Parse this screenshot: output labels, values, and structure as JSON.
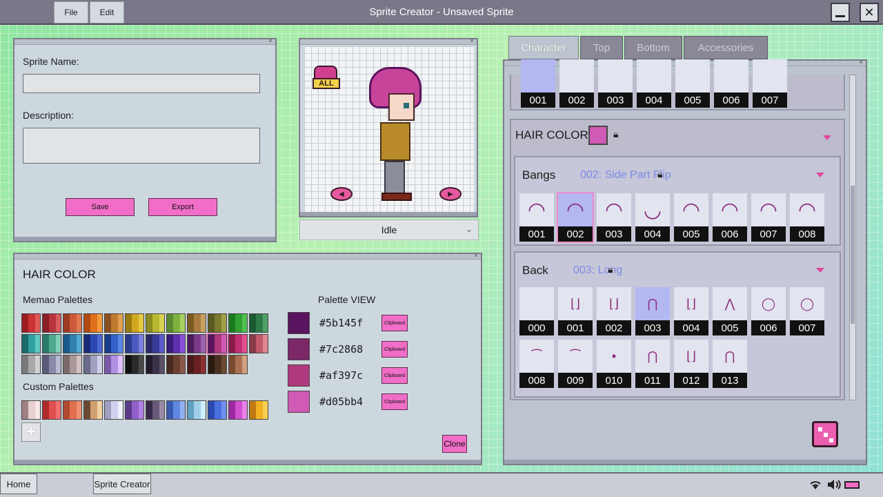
{
  "window": {
    "title": "Sprite Creator - Unsaved Sprite"
  },
  "menu": {
    "file": "File",
    "edit": "Edit"
  },
  "window_controls": {
    "minimize": "—",
    "close": "✕"
  },
  "sprite_info": {
    "name_label": "Sprite Name:",
    "description_label": "Description:",
    "save": "Save",
    "export": "Export"
  },
  "preview": {
    "animation_selected": "Idle",
    "all_badge": "ALL",
    "prev_arrow": "◀",
    "next_arrow": "▶"
  },
  "palette_panel": {
    "title": "HAIR COLOR",
    "memao_label": "Memao Palettes",
    "custom_label": "Custom Palettes",
    "view_label": "Palette VIEW",
    "clipboard_label": "Clipboard",
    "clone": "Clone",
    "colors": [
      {
        "hex": "#5b145f"
      },
      {
        "hex": "#7c2868"
      },
      {
        "hex": "#af397c"
      },
      {
        "hex": "#d05bb4"
      }
    ],
    "memao_swatches": [
      [
        "#9b1d22",
        "#cc3335",
        "#e05a5a"
      ],
      [
        "#8a1f26",
        "#b8343c",
        "#d85a5e"
      ],
      [
        "#9c3a22",
        "#cc5a3a",
        "#e07a50"
      ],
      [
        "#b04a10",
        "#e0701a",
        "#f59a3a"
      ],
      [
        "#8a5020",
        "#c07a30",
        "#e0a050"
      ],
      [
        "#9a7a10",
        "#d0a820",
        "#e8c840"
      ],
      [
        "#8a8a20",
        "#b8b830",
        "#d8d050"
      ],
      [
        "#5a8a30",
        "#80b040",
        "#a8d060"
      ],
      [
        "#7a5a20",
        "#a87a40",
        "#c8a060"
      ],
      [
        "#5a5a20",
        "#7a7a30",
        "#a0a048"
      ],
      [
        "#1a7a20",
        "#30a030",
        "#50c050"
      ],
      [
        "#1a5a30",
        "#307a48",
        "#50a068"
      ],
      [
        "#1a6a6a",
        "#30a0a0",
        "#60c8c0"
      ],
      [
        "#2a7a6a",
        "#50a890",
        "#80d0b8"
      ],
      [
        "#1a5a8a",
        "#3080b0",
        "#50a8d0"
      ],
      [
        "#1a2a7a",
        "#2a48b0",
        "#4a68d0"
      ],
      [
        "#1a3a8a",
        "#3060c8",
        "#5a88e8"
      ],
      [
        "#2a3a8a",
        "#4a5ac0",
        "#7a80e0"
      ],
      [
        "#2a2a6a",
        "#3a3a9a",
        "#5a5ac8"
      ],
      [
        "#3a1a7a",
        "#6030b0",
        "#8a50d8"
      ],
      [
        "#4a1a5a",
        "#7a3a8a",
        "#a060b0"
      ],
      [
        "#5b145f",
        "#af397c",
        "#d05bb4"
      ],
      [
        "#8a1a4a",
        "#c03070",
        "#e05090"
      ],
      [
        "#8a3a4a",
        "#c05a6a",
        "#e08890"
      ],
      [
        "#7a7a7a",
        "#a8a8a8",
        "#d0d0d0"
      ],
      [
        "#5a5a7a",
        "#8a8aa8",
        "#b8b8d0"
      ],
      [
        "#7a6a6a",
        "#a89898",
        "#d0c0c0"
      ],
      [
        "#6a6a8a",
        "#a0a0c0",
        "#d0d0e8"
      ],
      [
        "#7a5aa8",
        "#b090e0",
        "#e0c0ff"
      ],
      [
        "#101010",
        "#2a2a2a",
        "#4a4a4a"
      ],
      [
        "#201a2a",
        "#3a3048",
        "#5a5068"
      ],
      [
        "#4a2a20",
        "#6a4030",
        "#8a5a48"
      ],
      [
        "#4a1a1a",
        "#6a2020",
        "#8a3030"
      ],
      [
        "#2a1a10",
        "#4a3020",
        "#6a4a30"
      ],
      [
        "#7a4a30",
        "#a87050",
        "#d0a080"
      ]
    ],
    "custom_swatches": [
      [
        "#a08080",
        "#e8d0d0",
        "#f8e8e8"
      ],
      [
        "#b02a2a",
        "#e05050",
        "#f07070"
      ],
      [
        "#b04a30",
        "#e07050",
        "#f09070"
      ],
      [
        "#6a4a30",
        "#d0a070",
        "#f0d0a0"
      ],
      [
        "#a0a0c0",
        "#d0d0f0",
        "#f0f0ff"
      ],
      [
        "#5a3a8a",
        "#9060c8",
        "#b080e8"
      ],
      [
        "#3a2a4a",
        "#6a5a7a",
        "#9a8aa8"
      ],
      [
        "#3a5ab0",
        "#6088e0",
        "#90b0f0"
      ],
      [
        "#60a0c0",
        "#a0d0e8",
        "#d0f0ff"
      ],
      [
        "#2a4ab0",
        "#4a70e0",
        "#7090f0"
      ],
      [
        "#9a2aa0",
        "#d050d0",
        "#e880e8"
      ],
      [
        "#c07a10",
        "#f0b020",
        "#f8d050"
      ]
    ]
  },
  "tabs": [
    "Character",
    "Top",
    "Bottom",
    "Accessories"
  ],
  "character": {
    "top_row": [
      "001",
      "002",
      "003",
      "004",
      "005",
      "006",
      "007"
    ],
    "hair_color": {
      "title": "HAIR COLOR",
      "swatch_color": "#d05bb4"
    },
    "bangs": {
      "title": "Bangs",
      "value": "002: Side Part Flip",
      "items": [
        "001",
        "002",
        "003",
        "004",
        "005",
        "006",
        "007",
        "008"
      ]
    },
    "back": {
      "title": "Back",
      "value": "003: Long",
      "items": [
        "000",
        "001",
        "002",
        "003",
        "004",
        "005",
        "006",
        "007",
        "008",
        "009",
        "010",
        "011",
        "012",
        "013"
      ]
    }
  },
  "taskbar": {
    "home": "Home",
    "app": "Sprite Creator"
  },
  "icons": [
    "wifi-icon",
    "speaker-icon",
    "battery-icon",
    "lock-icon",
    "dice-icon"
  ]
}
